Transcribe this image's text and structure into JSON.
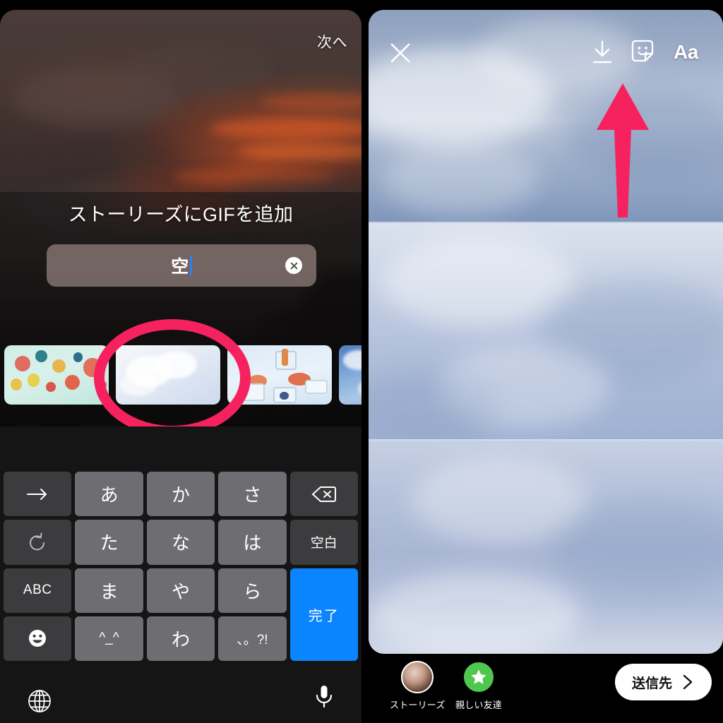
{
  "left_panel": {
    "next_button": "次へ",
    "gif_sheet": {
      "title": "ストーリーズにGIFを追加",
      "search": {
        "value": "空",
        "clear_icon": "close-circle-icon"
      },
      "results": [
        {
          "alt": "hot-air-balloons-gif"
        },
        {
          "alt": "white-sky-clouds-gif",
          "highlighted": true
        },
        {
          "alt": "food-drink-flatlay-gif"
        },
        {
          "alt": "blue-sky-clouds-gif"
        }
      ]
    },
    "annotation": {
      "type": "ellipse",
      "color": "#f62260",
      "target": "white-sky-clouds-gif"
    },
    "keyboard": {
      "rows": [
        [
          {
            "label": "→",
            "name": "cursor-right-key",
            "type": "fn",
            "icon": "arrow-right-icon"
          },
          {
            "label": "あ",
            "name": "kana-a-key",
            "type": "char"
          },
          {
            "label": "か",
            "name": "kana-ka-key",
            "type": "char"
          },
          {
            "label": "さ",
            "name": "kana-sa-key",
            "type": "char"
          },
          {
            "label": "",
            "name": "backspace-key",
            "type": "fn",
            "icon": "backspace-icon"
          }
        ],
        [
          {
            "label": "",
            "name": "undo-key",
            "type": "fn",
            "icon": "undo-icon"
          },
          {
            "label": "た",
            "name": "kana-ta-key",
            "type": "char"
          },
          {
            "label": "な",
            "name": "kana-na-key",
            "type": "char"
          },
          {
            "label": "は",
            "name": "kana-ha-key",
            "type": "char"
          },
          {
            "label": "空白",
            "name": "space-key",
            "type": "fn",
            "small": true
          }
        ],
        [
          {
            "label": "ABC",
            "name": "abc-key",
            "type": "fn",
            "small": true
          },
          {
            "label": "ま",
            "name": "kana-ma-key",
            "type": "char"
          },
          {
            "label": "や",
            "name": "kana-ya-key",
            "type": "char"
          },
          {
            "label": "ら",
            "name": "kana-ra-key",
            "type": "char"
          },
          {
            "label": "完了",
            "name": "done-key",
            "type": "done"
          }
        ],
        [
          {
            "label": "",
            "name": "emoji-key",
            "type": "fn",
            "icon": "emoji-icon"
          },
          {
            "label": "^_^",
            "name": "kaomoji-key",
            "type": "char",
            "small": true
          },
          {
            "label": "わ",
            "name": "kana-wa-key",
            "type": "char"
          },
          {
            "label": "、。?!",
            "name": "punctuation-key",
            "type": "char",
            "small": true
          }
        ]
      ],
      "globe_icon": "globe-icon",
      "mic_icon": "microphone-icon",
      "done_color": "#0a84ff"
    }
  },
  "right_panel": {
    "top_icons": [
      {
        "name": "close-icon",
        "label": "×"
      },
      {
        "name": "download-icon",
        "label": "↓"
      },
      {
        "name": "sticker-icon",
        "label": "sticker"
      },
      {
        "name": "text-tool-icon",
        "label": "Aa"
      }
    ],
    "annotation": {
      "type": "arrow",
      "color": "#f62260",
      "points_to": "download-icon"
    },
    "bottom_bar": {
      "destinations": [
        {
          "label": "ストーリーズ",
          "name": "destination-stories",
          "icon": "avatar"
        },
        {
          "label": "親しい友達",
          "name": "destination-close-friends",
          "icon": "green-star-icon"
        }
      ],
      "send_button": {
        "label": "送信先",
        "chevron": "chevron-right-icon"
      }
    }
  }
}
